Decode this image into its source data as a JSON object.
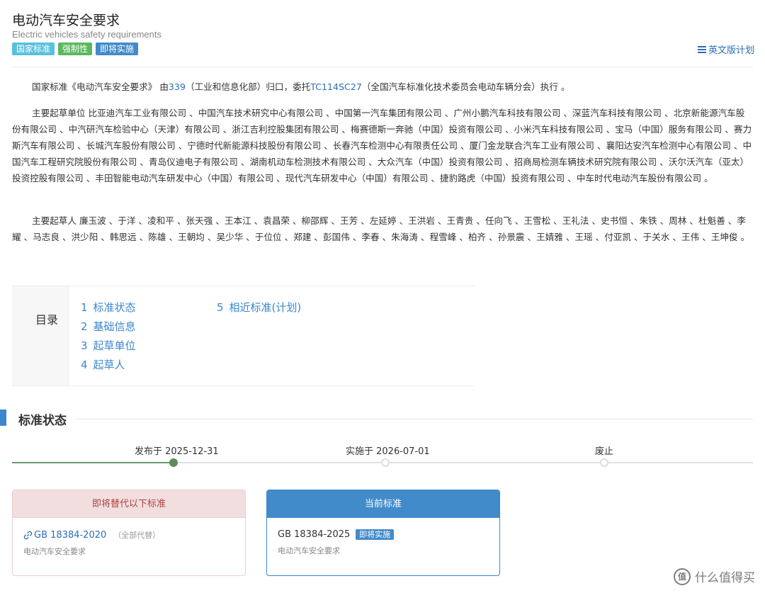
{
  "header": {
    "title": "电动汽车安全要求",
    "subtitle": "Electric vehicles safety requirements",
    "badges": [
      "国家标准",
      "强制性",
      "即将实施"
    ],
    "en_plan_link": "英文版计划"
  },
  "intro": {
    "p1_a": "国家标准《电动汽车安全要求》 由",
    "p1_link1": "339",
    "p1_b": "（工业和信息化部）归口，委托",
    "p1_link2": "TC114SC27",
    "p1_c": "（全国汽车标准化技术委员会电动车辆分会）执行 。",
    "p2": "主要起草单位 比亚迪汽车工业有限公司 、中国汽车技术研究中心有限公司 、中国第一汽车集团有限公司 、广州小鹏汽车科技有限公司 、深蓝汽车科技有限公司 、北京新能源汽车股份有限公司 、中汽研汽车检验中心（天津）有限公司 、浙江吉利控股集团有限公司 、梅赛德斯一奔驰（中国）投资有限公司 、小米汽车科技有限公司 、宝马（中国）服务有限公司 、赛力斯汽车有限公司 、长城汽车股份有限公司 、宁德时代新能源科技股份有限公司 、长春汽车检测中心有限责任公司 、厦门金龙联合汽车工业有限公司 、襄阳达安汽车检测中心有限公司 、中国汽车工程研究院股份有限公司 、青岛仪迪电子有限公司 、湖南机动车检测技术有限公司 、大众汽车（中国）投资有限公司 、招商局检测车辆技术研究院有限公司 、沃尔沃汽车（亚太）投资控股有限公司 、丰田智能电动汽车研发中心（中国）有限公司 、现代汽车研发中心（中国）有限公司 、捷豹路虎（中国）投资有限公司 、中车时代电动汽车股份有限公司 。",
    "p3": "主要起草人 廉玉波 、于洋 、凌和平 、张天强 、王本江 、袁昌荣 、柳邵辉 、王芳 、左延婷 、王洪岩 、王青贵 、任向飞 、王雪松 、王礼法 、史书恒 、朱铁 、周林 、杜魁善 、李耀 、马志良 、洪少阳 、韩思远 、陈雄 、王朝均 、吴少华 、于位位 、郑建 、彭国伟 、李春 、朱海涛 、程雪峰 、柏齐 、孙景震 、王婧雅 、王瑶 、付亚凯 、于关水 、王伟 、王坤俊 。"
  },
  "toc": {
    "title": "目录",
    "items": [
      {
        "num": "1",
        "label": "标准状态"
      },
      {
        "num": "2",
        "label": "基础信息"
      },
      {
        "num": "3",
        "label": "起草单位"
      },
      {
        "num": "4",
        "label": "起草人"
      },
      {
        "num": "5",
        "label": "相近标准(计划)"
      }
    ]
  },
  "status_section": {
    "title": "标准状态",
    "timeline": [
      {
        "label": "发布于 2025-12-31",
        "state": "done"
      },
      {
        "label": "实施于 2026-07-01",
        "state": "pending"
      },
      {
        "label": "废止",
        "state": "pending"
      }
    ]
  },
  "cards": {
    "replace": {
      "header": "即将替代以下标准",
      "code": "GB 18384-2020",
      "note": "（全部代替）",
      "name": "电动汽车安全要求"
    },
    "current": {
      "header": "当前标准",
      "code": "GB 18384-2025",
      "badge": "即将实施",
      "name": "电动汽车安全要求"
    }
  },
  "watermark": "什么值得买",
  "colors": {
    "link": "#2a6eb5",
    "accent": "#3b86cf",
    "badge_blue": "#5bc0de",
    "badge_green": "#5cb85c",
    "badge_primary": "#428bca",
    "danger_bg": "#f2dede"
  }
}
